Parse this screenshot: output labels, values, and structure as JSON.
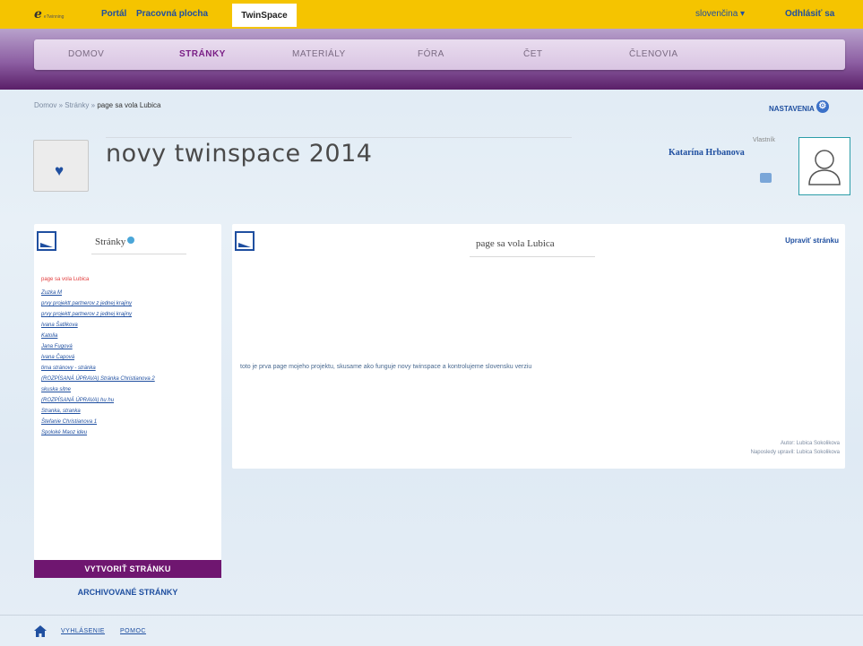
{
  "topbar": {
    "logo_text": "eTwinning",
    "portal": "Portál",
    "workspace": "Pracovná plocha",
    "twinspace": "TwinSpace",
    "language": "slovenčina ▾",
    "logout": "Odhlásiť sa"
  },
  "nav": {
    "items": [
      "DOMOV",
      "STRÁNKY",
      "MATERIÁLY",
      "FÓRA",
      "ČET",
      "ČLENOVIA"
    ],
    "active": "STRÁNKY"
  },
  "breadcrumb": {
    "home": "Domov",
    "sep": "»",
    "pages": "Stránky",
    "current": "page sa vola Lubica"
  },
  "settings_label": "NASTAVENIA",
  "twinspace": {
    "title": "novy twinspace 2014",
    "owner_label": "Vlastník",
    "owner_name": "Katarína Hrbanova"
  },
  "left_panel": {
    "title": "Stránky",
    "pages": [
      "page sa vola Lubica",
      "Zuzka M",
      "prvy projektt partnerov z jednej krajiny",
      "prvy projektt partnerov z jednej krajiny",
      "Ivana Šatlikova",
      "Katolia",
      "Jana Fugová",
      "Ivana Čapová",
      "tima stránovy - stránka",
      "(ROZPÍSANÁ ÚPRAVA) Stránka Christianova 2",
      "skuska sitne",
      "(ROZPÍSANÁ ÚPRAVA) hu hu",
      "Stranka, stranka",
      "Štefanie Christianova 1",
      "Spoloké Maoz ideu"
    ],
    "create_button": "VYTVORIŤ STRÁNKU",
    "archive_link": "ARCHIVOVANÉ STRÁNKY"
  },
  "main_panel": {
    "page_title": "page sa vola Lubica",
    "edit_link": "Upraviť stránku",
    "body": "toto je prva page mojeho projektu, skusame ako funguje novy twinspace a kontrolujeme slovensku verziu",
    "author": "Autor: Lubica Sokolikova",
    "last_edit": "Naposledy upravil: Lubica Sokolikova"
  },
  "footer": {
    "links": [
      "VYHLÁSENIE",
      "POMOC"
    ]
  },
  "colors": {
    "topbar": "#f5c400",
    "purple": "#6f1670",
    "link_blue": "#1f4fa0"
  }
}
